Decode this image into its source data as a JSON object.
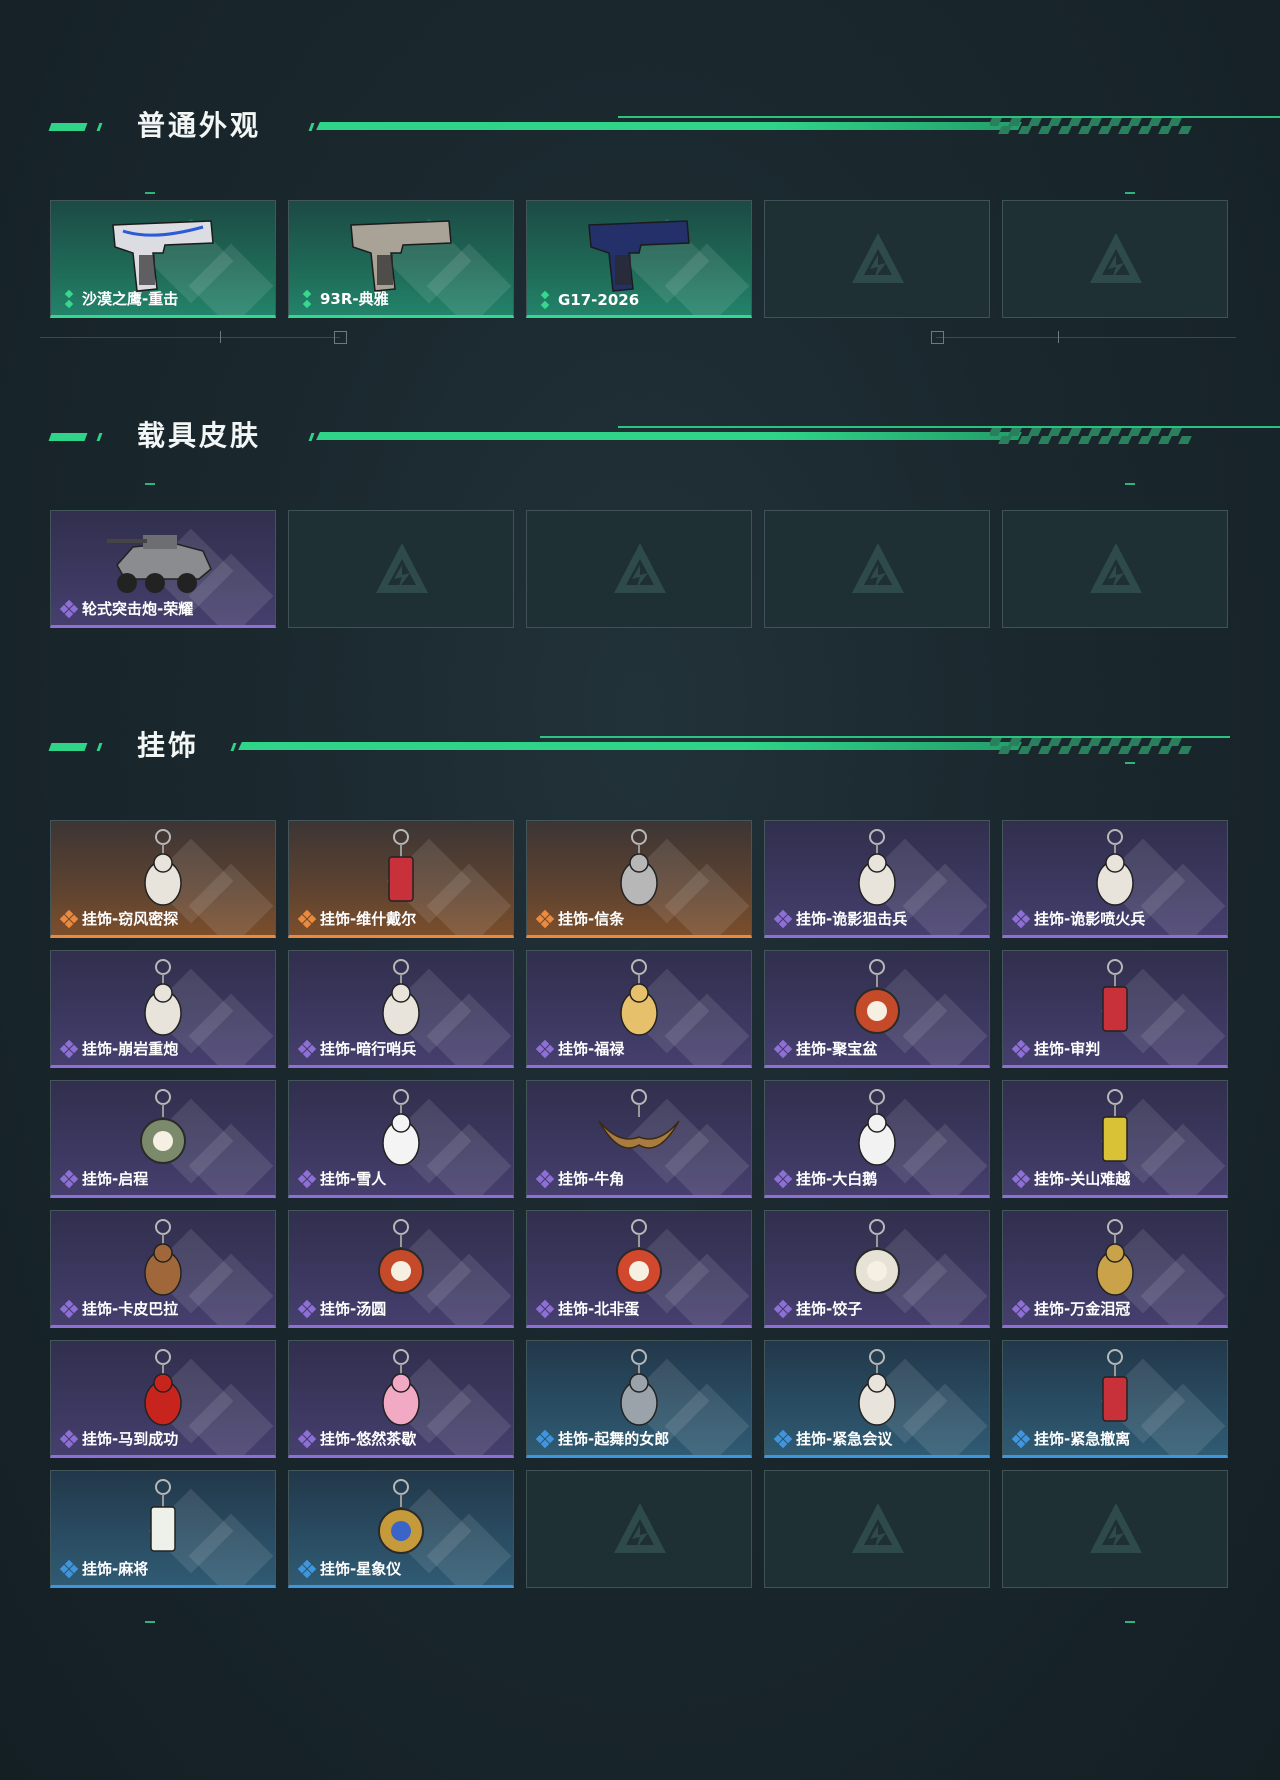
{
  "colors": {
    "accent": "#2fd488",
    "green_rarity": "#36d890",
    "purple_rarity": "#8d6fd6",
    "orange_rarity": "#e98a3e",
    "blue_rarity": "#3f96de"
  },
  "sections": [
    {
      "title": "普通外观",
      "items": [
        {
          "label": "沙漠之鹰-重击",
          "rarity": "green",
          "icon": "desert-eagle-pistol-icon"
        },
        {
          "label": "93R-典雅",
          "rarity": "green",
          "icon": "93r-pistol-icon"
        },
        {
          "label": "G17-2026",
          "rarity": "green",
          "icon": "g17-pistol-icon"
        },
        {
          "label": "",
          "rarity": "empty",
          "icon": "empty-slot-logo-icon"
        },
        {
          "label": "",
          "rarity": "empty",
          "icon": "empty-slot-logo-icon"
        }
      ]
    },
    {
      "title": "载具皮肤",
      "items": [
        {
          "label": "轮式突击炮-荣耀",
          "rarity": "purple",
          "icon": "wheeled-assault-gun-icon"
        },
        {
          "label": "",
          "rarity": "empty",
          "icon": "empty-slot-logo-icon"
        },
        {
          "label": "",
          "rarity": "empty",
          "icon": "empty-slot-logo-icon"
        },
        {
          "label": "",
          "rarity": "empty",
          "icon": "empty-slot-logo-icon"
        },
        {
          "label": "",
          "rarity": "empty",
          "icon": "empty-slot-logo-icon"
        }
      ]
    },
    {
      "title": "挂饰",
      "items": [
        {
          "label": "挂饰-窃风密探",
          "rarity": "orange",
          "icon": "charm-figure-icon"
        },
        {
          "label": "挂饰-维什戴尔",
          "rarity": "orange",
          "icon": "charm-card-icon"
        },
        {
          "label": "挂饰-信条",
          "rarity": "orange",
          "icon": "charm-trophy-icon"
        },
        {
          "label": "挂饰-诡影狙击兵",
          "rarity": "purple",
          "icon": "charm-figure-icon"
        },
        {
          "label": "挂饰-诡影喷火兵",
          "rarity": "purple",
          "icon": "charm-figure-icon"
        },
        {
          "label": "挂饰-崩岩重炮",
          "rarity": "purple",
          "icon": "charm-figure-icon"
        },
        {
          "label": "挂饰-暗行哨兵",
          "rarity": "purple",
          "icon": "charm-figure-icon"
        },
        {
          "label": "挂饰-福禄",
          "rarity": "purple",
          "icon": "charm-gourd-icon"
        },
        {
          "label": "挂饰-聚宝盆",
          "rarity": "purple",
          "icon": "charm-bowl-icon"
        },
        {
          "label": "挂饰-审判",
          "rarity": "purple",
          "icon": "charm-card-icon"
        },
        {
          "label": "挂饰-启程",
          "rarity": "purple",
          "icon": "charm-ring-icon"
        },
        {
          "label": "挂饰-雪人",
          "rarity": "purple",
          "icon": "charm-snowman-icon"
        },
        {
          "label": "挂饰-牛角",
          "rarity": "purple",
          "icon": "charm-horn-icon"
        },
        {
          "label": "挂饰-大白鹅",
          "rarity": "purple",
          "icon": "charm-goose-icon"
        },
        {
          "label": "挂饰-关山难越",
          "rarity": "purple",
          "icon": "charm-bar-icon"
        },
        {
          "label": "挂饰-卡皮巴拉",
          "rarity": "purple",
          "icon": "charm-capybara-icon"
        },
        {
          "label": "挂饰-汤圆",
          "rarity": "purple",
          "icon": "charm-bowl-icon"
        },
        {
          "label": "挂饰-北非蛋",
          "rarity": "purple",
          "icon": "charm-pan-icon"
        },
        {
          "label": "挂饰-饺子",
          "rarity": "purple",
          "icon": "charm-plate-icon"
        },
        {
          "label": "挂饰-万金泪冠",
          "rarity": "purple",
          "icon": "charm-burger-icon"
        },
        {
          "label": "挂饰-马到成功",
          "rarity": "purple",
          "icon": "charm-horse-icon"
        },
        {
          "label": "挂饰-悠然茶歇",
          "rarity": "purple",
          "icon": "charm-cupcake-icon"
        },
        {
          "label": "挂饰-起舞的女郎",
          "rarity": "blue",
          "icon": "charm-dancer-icon"
        },
        {
          "label": "挂饰-紧急会议",
          "rarity": "blue",
          "icon": "charm-figure-icon"
        },
        {
          "label": "挂饰-紧急撤离",
          "rarity": "blue",
          "icon": "charm-card-icon"
        },
        {
          "label": "挂饰-麻将",
          "rarity": "blue",
          "icon": "charm-mahjong-icon"
        },
        {
          "label": "挂饰-星象仪",
          "rarity": "blue",
          "icon": "charm-astrolabe-icon"
        },
        {
          "label": "",
          "rarity": "empty",
          "icon": "empty-slot-logo-icon"
        },
        {
          "label": "",
          "rarity": "empty",
          "icon": "empty-slot-logo-icon"
        },
        {
          "label": "",
          "rarity": "empty",
          "icon": "empty-slot-logo-icon"
        }
      ]
    }
  ]
}
